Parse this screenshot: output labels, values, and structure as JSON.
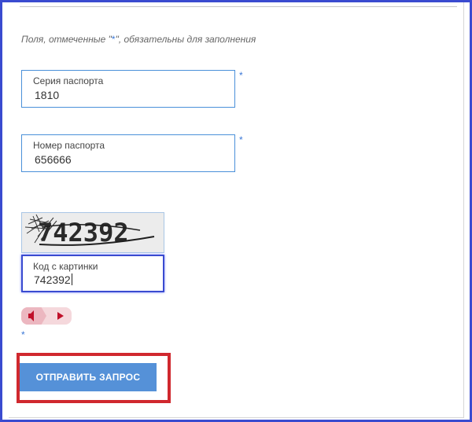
{
  "form": {
    "required_note_prefix": "Поля, отмеченные \"",
    "required_note_star": "*",
    "required_note_suffix": "\", обязательны для заполнения",
    "required_marker": "*",
    "passport_series": {
      "label": "Серия паспорта",
      "value": "1810"
    },
    "passport_number": {
      "label": "Номер паспорта",
      "value": "656666"
    },
    "captcha": {
      "image_text": "742392",
      "label": "Код с картинки",
      "value": "742392"
    },
    "audio": {
      "speaker_icon": "speaker-icon",
      "play_icon": "play-icon"
    },
    "submit_label": "ОТПРАВИТЬ ЗАПРОС"
  },
  "colors": {
    "frame_border": "#3a4bd0",
    "field_border": "#4a90d9",
    "button_bg": "#5591d8",
    "highlight": "#d0282e",
    "audio_bg": "#f5d8dc",
    "audio_icon": "#c0102a"
  }
}
